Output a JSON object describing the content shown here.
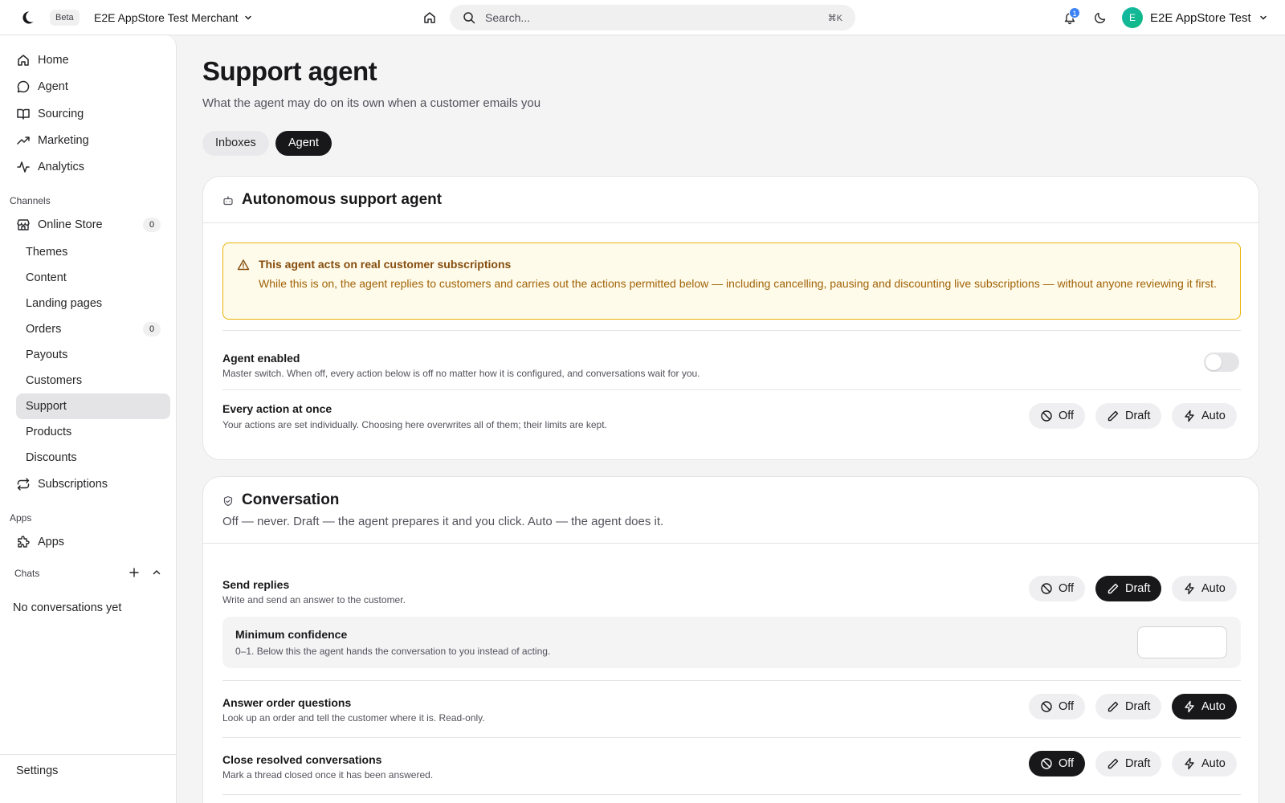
{
  "topbar": {
    "beta": "Beta",
    "merchant": "E2E AppStore Test Merchant",
    "search_placeholder": "Search...",
    "search_shortcut": "⌘K",
    "notification_count": "1",
    "user_initial": "E",
    "user_name": "E2E AppStore Test"
  },
  "sidebar": {
    "nav": [
      {
        "label": "Home",
        "icon": "home-icon"
      },
      {
        "label": "Agent",
        "icon": "chat-bubble-icon"
      },
      {
        "label": "Sourcing",
        "icon": "book-icon"
      },
      {
        "label": "Marketing",
        "icon": "trending-up-icon"
      },
      {
        "label": "Analytics",
        "icon": "activity-icon"
      }
    ],
    "channels_label": "Channels",
    "online_store": {
      "label": "Online Store",
      "count": "0",
      "icon": "store-icon"
    },
    "sub_items": [
      {
        "label": "Themes"
      },
      {
        "label": "Content"
      },
      {
        "label": "Landing pages"
      },
      {
        "label": "Orders",
        "count": "0"
      },
      {
        "label": "Payouts"
      },
      {
        "label": "Customers"
      },
      {
        "label": "Support"
      },
      {
        "label": "Products"
      },
      {
        "label": "Discounts"
      }
    ],
    "subscriptions": {
      "label": "Subscriptions",
      "icon": "repeat-icon"
    },
    "apps_label": "Apps",
    "apps_item": {
      "label": "Apps",
      "icon": "puzzle-icon"
    },
    "chats_label": "Chats",
    "no_conversations": "No conversations yet",
    "settings": "Settings"
  },
  "page": {
    "title": "Support agent",
    "subtitle": "What the agent may do on its own when a customer emails you",
    "tabs": [
      {
        "label": "Inboxes",
        "active": false
      },
      {
        "label": "Agent",
        "active": true
      }
    ]
  },
  "mode_labels": {
    "off": "Off",
    "draft": "Draft",
    "auto": "Auto"
  },
  "autonomous": {
    "title": "Autonomous support agent",
    "warning_title": "This agent acts on real customer subscriptions",
    "warning_text": "While this is on, the agent replies to customers and carries out the actions permitted below — including cancelling, pausing and discounting live subscriptions — without anyone reviewing it first.",
    "enabled_title": "Agent enabled",
    "enabled_desc": "Master switch. When off, every action below is off no matter how it is configured, and conversations wait for you.",
    "enabled": false,
    "every_title": "Every action at once",
    "every_desc": "Your actions are set individually. Choosing here overwrites all of them; their limits are kept."
  },
  "conversation": {
    "title": "Conversation",
    "subtitle": "Off — never. Draft — the agent prepares it and you click. Auto — the agent does it.",
    "send_replies": {
      "title": "Send replies",
      "desc": "Write and send an answer to the customer.",
      "mode": "draft",
      "confidence_title": "Minimum confidence",
      "confidence_desc": "0–1. Below this the agent hands the conversation to you instead of acting.",
      "confidence_value": ""
    },
    "answer_orders": {
      "title": "Answer order questions",
      "desc": "Look up an order and tell the customer where it is. Read-only.",
      "mode": "auto"
    },
    "close_resolved": {
      "title": "Close resolved conversations",
      "desc": "Mark a thread closed once it has been answered.",
      "mode": "off"
    }
  }
}
